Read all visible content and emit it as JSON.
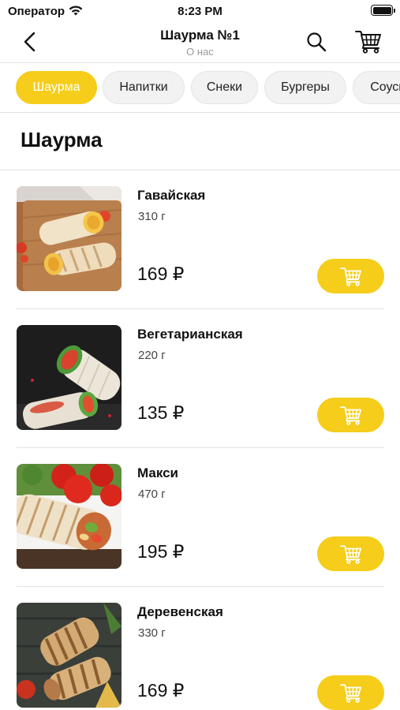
{
  "status": {
    "carrier": "Оператор",
    "time": "8:23 PM",
    "battery": 1.0
  },
  "header": {
    "title": "Шаурма №1",
    "subtitle": "О нас"
  },
  "categories": [
    {
      "label": "Шаурма",
      "active": true
    },
    {
      "label": "Напитки",
      "active": false
    },
    {
      "label": "Снеки",
      "active": false
    },
    {
      "label": "Бургеры",
      "active": false
    },
    {
      "label": "Соусы",
      "active": false
    }
  ],
  "section": {
    "title": "Шаурма"
  },
  "products": [
    {
      "name": "Гавайская",
      "weight": "310 г",
      "price": "169 ₽"
    },
    {
      "name": "Вегетарианская",
      "weight": "220 г",
      "price": "135 ₽"
    },
    {
      "name": "Макси",
      "weight": "470 г",
      "price": "195 ₽"
    },
    {
      "name": "Деревенская",
      "weight": "330 г",
      "price": "169 ₽"
    }
  ],
  "colors": {
    "accent": "#f5cd1a",
    "chip_bg": "#f2f2f2",
    "divider": "#e2e2e2"
  }
}
